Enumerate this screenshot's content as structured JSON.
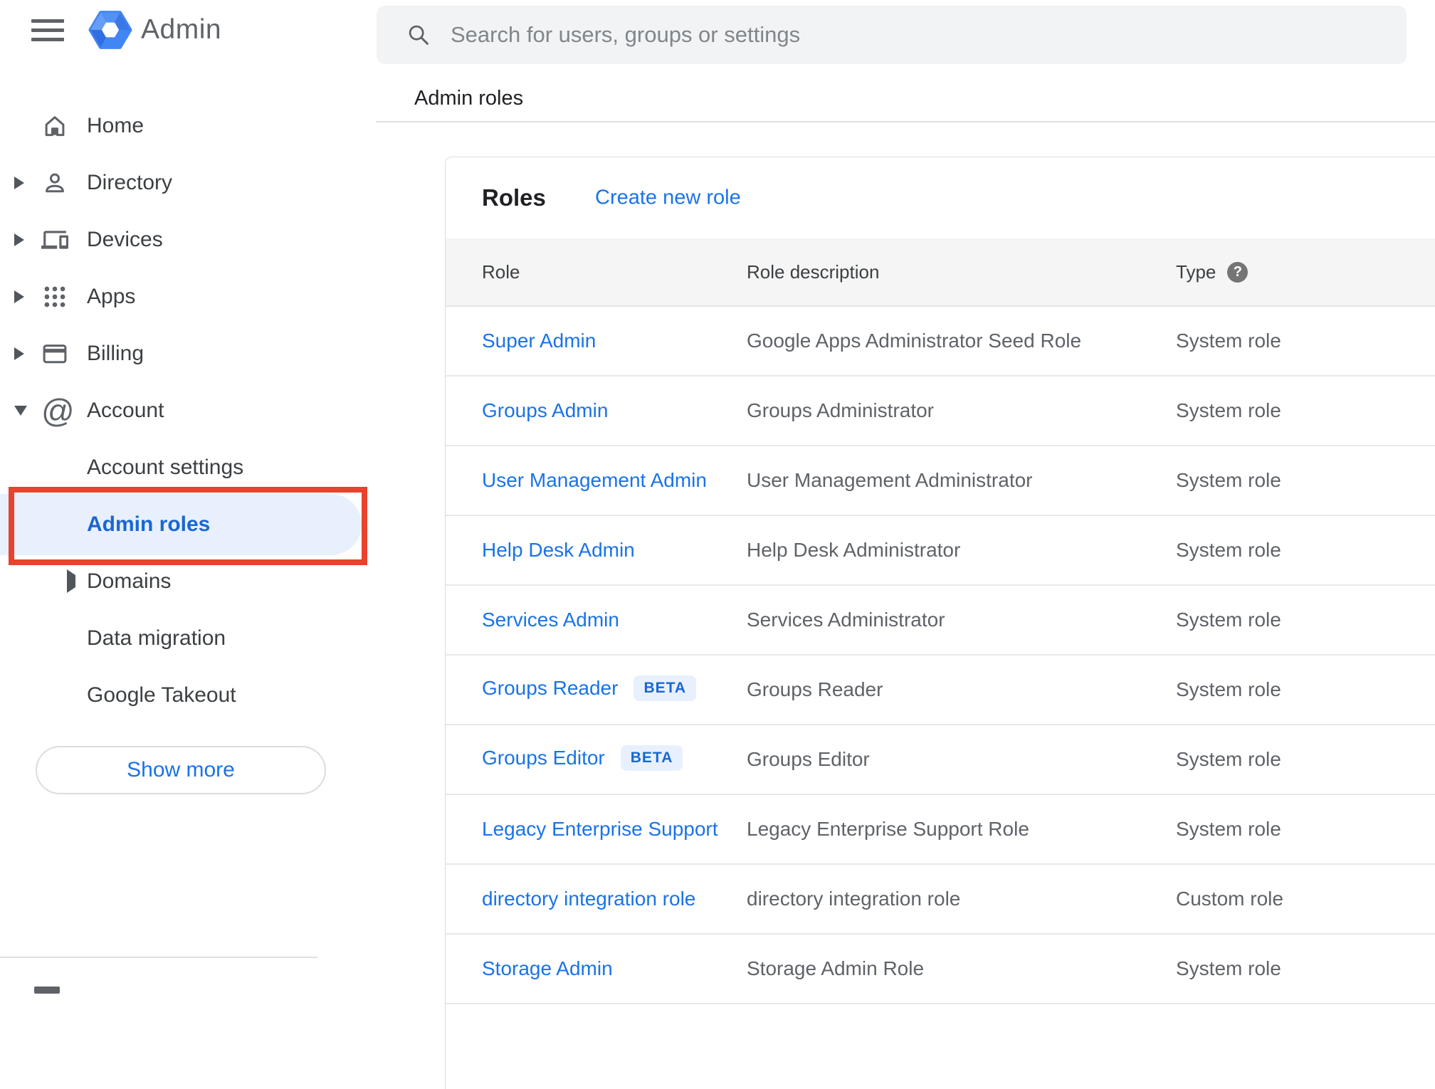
{
  "colors": {
    "accent_blue": "#1a73e8",
    "selected_text_blue": "#1967d2",
    "selected_bg_blue": "#e8f0fe",
    "annotation_red": "#e8432c",
    "logo_blue": "#4285f4",
    "text_dark": "#202124",
    "text_gray": "#5f6368",
    "search_bg": "#f1f3f4",
    "table_header_bg": "#f5f5f5",
    "divider": "#e0e0e0"
  },
  "header": {
    "app_title": "Admin",
    "search_placeholder": "Search for users, groups or settings",
    "breadcrumb": "Admin roles"
  },
  "sidebar": {
    "items": [
      {
        "label": "Home",
        "icon": "home",
        "expandable": false
      },
      {
        "label": "Directory",
        "icon": "person",
        "expandable": true
      },
      {
        "label": "Devices",
        "icon": "devices",
        "expandable": true
      },
      {
        "label": "Apps",
        "icon": "apps-grid",
        "expandable": true
      },
      {
        "label": "Billing",
        "icon": "credit-card",
        "expandable": true
      },
      {
        "label": "Account",
        "icon": "at-sign",
        "expandable": true,
        "expanded": true
      }
    ],
    "account_subitems": [
      {
        "label": "Account settings"
      },
      {
        "label": "Admin roles",
        "selected": true,
        "annotated": true
      },
      {
        "label": "Domains",
        "expandable": true
      },
      {
        "label": "Data migration"
      },
      {
        "label": "Google Takeout"
      }
    ],
    "show_more_label": "Show more"
  },
  "main": {
    "title": "Roles",
    "create_link_label": "Create new role",
    "table": {
      "columns": [
        "Role",
        "Role description",
        "Type"
      ],
      "type_help_glyph": "?",
      "rows": [
        {
          "role": "Super Admin",
          "badge": "",
          "description": "Google Apps Administrator Seed Role",
          "type": "System role"
        },
        {
          "role": "Groups Admin",
          "badge": "",
          "description": "Groups Administrator",
          "type": "System role"
        },
        {
          "role": "User Management Admin",
          "badge": "",
          "description": "User Management Administrator",
          "type": "System role"
        },
        {
          "role": "Help Desk Admin",
          "badge": "",
          "description": "Help Desk Administrator",
          "type": "System role"
        },
        {
          "role": "Services Admin",
          "badge": "",
          "description": "Services Administrator",
          "type": "System role"
        },
        {
          "role": "Groups Reader",
          "badge": "BETA",
          "description": "Groups Reader",
          "type": "System role"
        },
        {
          "role": "Groups Editor",
          "badge": "BETA",
          "description": "Groups Editor",
          "type": "System role"
        },
        {
          "role": "Legacy Enterprise Support",
          "badge": "",
          "description": "Legacy Enterprise Support Role",
          "type": "System role"
        },
        {
          "role": "directory integration role",
          "badge": "",
          "description": "directory integration role",
          "type": "Custom role"
        },
        {
          "role": "Storage Admin",
          "badge": "",
          "description": "Storage Admin Role",
          "type": "System role"
        }
      ]
    }
  }
}
